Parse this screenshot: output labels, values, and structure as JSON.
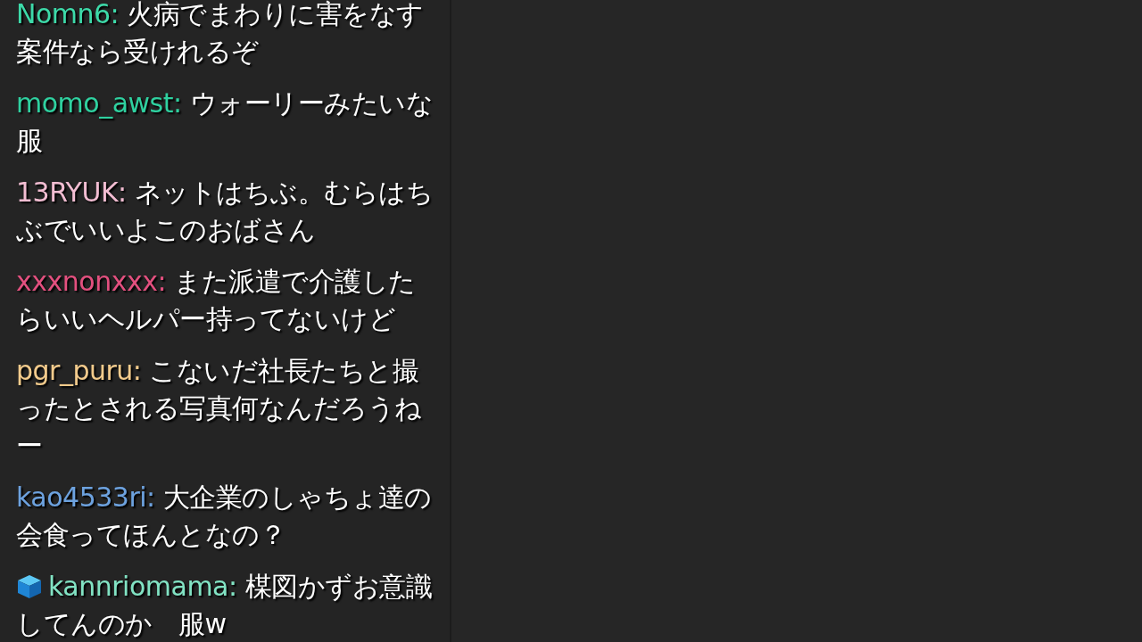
{
  "chat": {
    "messages": [
      {
        "user": "Nomn6:",
        "color": "#3ddaa9",
        "badge": false,
        "text": "火病でまわりに害をなす案件なら受けれるぞ"
      },
      {
        "user": "momo_awst:",
        "color": "#2fd1a0",
        "badge": false,
        "text": "ウォーリーみたいな服"
      },
      {
        "user": "13RYUK:",
        "color": "#f2bdd2",
        "badge": false,
        "text": "ネットはちぶ。むらはちぶでいいよこのおばさん"
      },
      {
        "user": "xxxnonxxx:",
        "color": "#e3507f",
        "badge": false,
        "text": "また派遣で介護したらいいヘルパー持ってないけど"
      },
      {
        "user": "pgr_puru:",
        "color": "#f3cb8c",
        "badge": false,
        "text": "こないだ社長たちと撮ったとされる写真何なんだろうねー"
      },
      {
        "user": "kao4533ri:",
        "color": "#6da2df",
        "badge": false,
        "text": "大企業のしゃちょ達の会食ってほんとなの？"
      },
      {
        "user": "kannriomama:",
        "color": "#82e3c4",
        "badge": true,
        "text": "楳図かずお意識してんのか　服w"
      }
    ]
  }
}
